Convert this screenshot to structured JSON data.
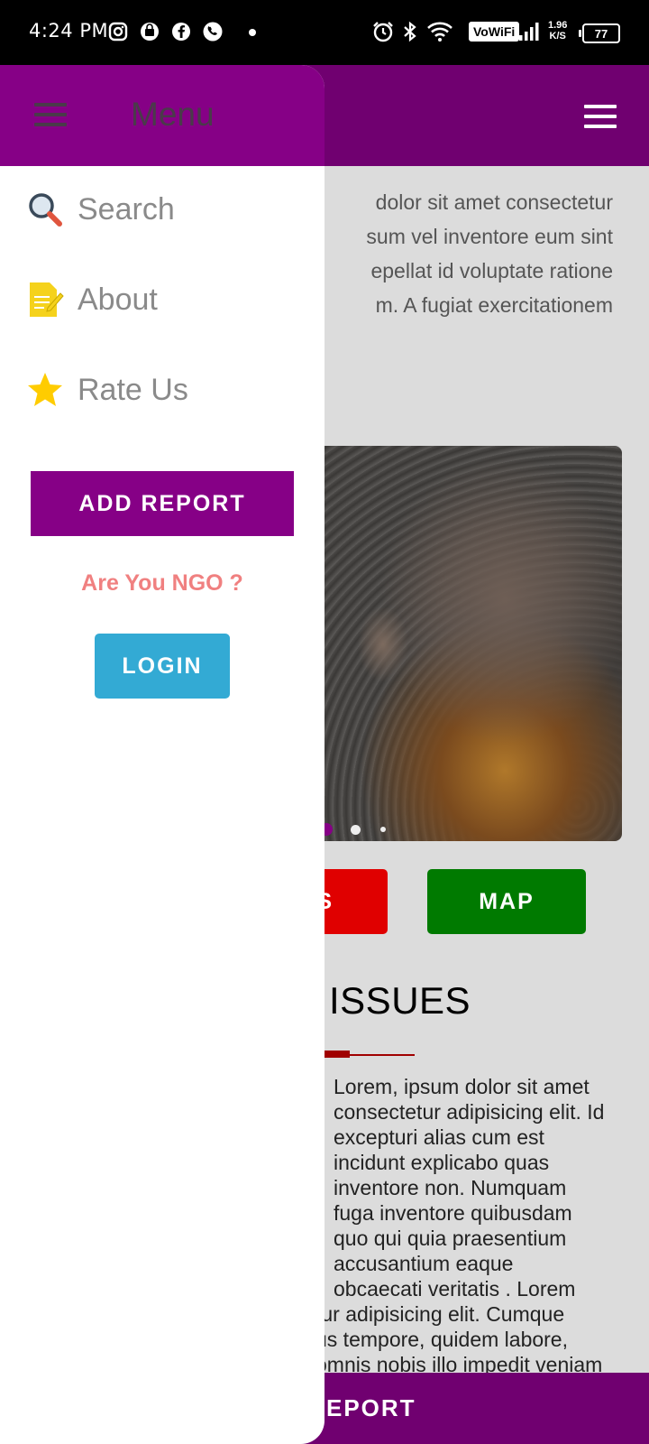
{
  "status_bar": {
    "time": "4:24 PM",
    "network_label": "VoWiFi",
    "speed_value": "1.96",
    "speed_unit": "K/S",
    "battery": "77"
  },
  "intro": {
    "lines": [
      "dolor sit amet consectetur",
      "sum vel inventore eum sint",
      "epellat id voluptate ratione",
      "m. A fugiat exercitationem"
    ]
  },
  "slider": {
    "active_index": 0,
    "count": 3
  },
  "actions": {
    "red_button_label": "S",
    "map_button_label": "MAP"
  },
  "issues": {
    "title": "ISSUES",
    "body_lines": [
      "Lorem, ipsum dolor sit amet",
      "consectetur adipisicing elit. Id",
      "excepturi alias cum est",
      "incidunt explicabo quas",
      "inventore non. Numquam",
      "fuga inventore quibusdam",
      "quo qui quia praesentium",
      "accusantium eaque",
      "obcaecati veritatis . Lorem",
      "tur adipisicing elit. Cumque",
      "us tempore, quidem labore,",
      "omnis nobis illo impedit veniam"
    ]
  },
  "bottom_bar": {
    "label": "EPORT"
  },
  "drawer": {
    "title": "Menu",
    "items": [
      {
        "label": "Search",
        "icon": "search-icon"
      },
      {
        "label": "About",
        "icon": "document-icon"
      },
      {
        "label": "Rate Us",
        "icon": "star-icon"
      }
    ],
    "add_report_label": "ADD REPORT",
    "ngo_prompt": "Are You NGO ?",
    "login_label": "LOGIN"
  },
  "colors": {
    "brand_purple": "#860086",
    "header_purple": "#700070",
    "login_blue": "#33aad4",
    "ngo_pink": "#f08080",
    "map_green": "#007a00",
    "alert_red": "#e00000"
  }
}
